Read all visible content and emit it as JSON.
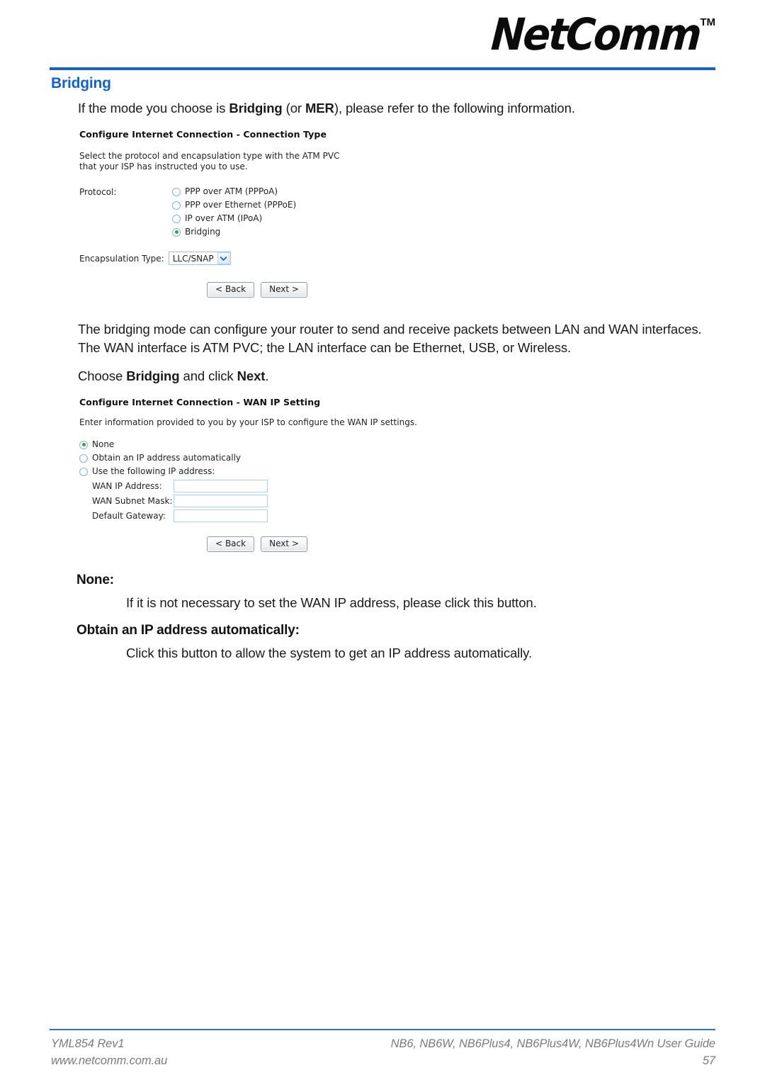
{
  "header": {
    "logo_text": "NetComm",
    "logo_tm": "TM",
    "accent_color": "#1064c8"
  },
  "section": {
    "title": "Bridging",
    "intro_prefix": "If the mode you choose is ",
    "intro_bold_1": "Bridging",
    "intro_mid": " (or ",
    "intro_bold_2": "MER",
    "intro_suffix": "), please refer to the following information."
  },
  "screenshot_1": {
    "title_bold": "Configure Internet Connection",
    "title_rest": " - Connection Type",
    "description": "Select the protocol and encapsulation type with the ATM PVC that your ISP has instructed you to use.",
    "protocol_label": "Protocol:",
    "protocol_options": [
      {
        "label": "PPP over ATM (PPPoA)",
        "selected": false
      },
      {
        "label": "PPP over Ethernet (PPPoE)",
        "selected": false
      },
      {
        "label": "IP over ATM (IPoA)",
        "selected": false
      },
      {
        "label": "Bridging",
        "selected": true
      }
    ],
    "encapsulation_label": "Encapsulation Type:",
    "encapsulation_value": "LLC/SNAP",
    "back_button": "< Back",
    "next_button": "Next >"
  },
  "paragraphs": {
    "bridging_mode": "The bridging mode can configure your router to send and receive packets between LAN and WAN interfaces. The WAN interface is ATM PVC; the LAN interface can be Ethernet, USB, or Wireless.",
    "choose_prefix": "Choose ",
    "choose_bold_1": "Bridging",
    "choose_mid": " and click ",
    "choose_bold_2": "Next",
    "choose_suffix": "."
  },
  "screenshot_2": {
    "title_bold": "Configure Internet Connection",
    "title_rest": " - WAN IP Setting",
    "description": "Enter information provided to you by your ISP to configure the WAN IP settings.",
    "options": [
      {
        "label": "None",
        "selected": true
      },
      {
        "label": "Obtain an IP address automatically",
        "selected": false
      },
      {
        "label": "Use the following IP address:",
        "selected": false
      }
    ],
    "fields": [
      {
        "label": "WAN IP Address:",
        "value": ""
      },
      {
        "label": "WAN Subnet Mask:",
        "value": ""
      },
      {
        "label": "Default Gateway:",
        "value": ""
      }
    ],
    "back_button": "< Back",
    "next_button": "Next >"
  },
  "definitions": [
    {
      "term": "None:",
      "text": "If it is not necessary to set the WAN IP address, please click this button."
    },
    {
      "term": "Obtain an IP address automatically:",
      "text": "Click this button to allow the system to get an IP address automatically."
    }
  ],
  "footer": {
    "left_line_1": "YML854 Rev1",
    "left_line_2": "www.netcomm.com.au",
    "right_line_1": "NB6, NB6W, NB6Plus4, NB6Plus4W, NB6Plus4Wn User Guide",
    "right_line_2": "57"
  }
}
